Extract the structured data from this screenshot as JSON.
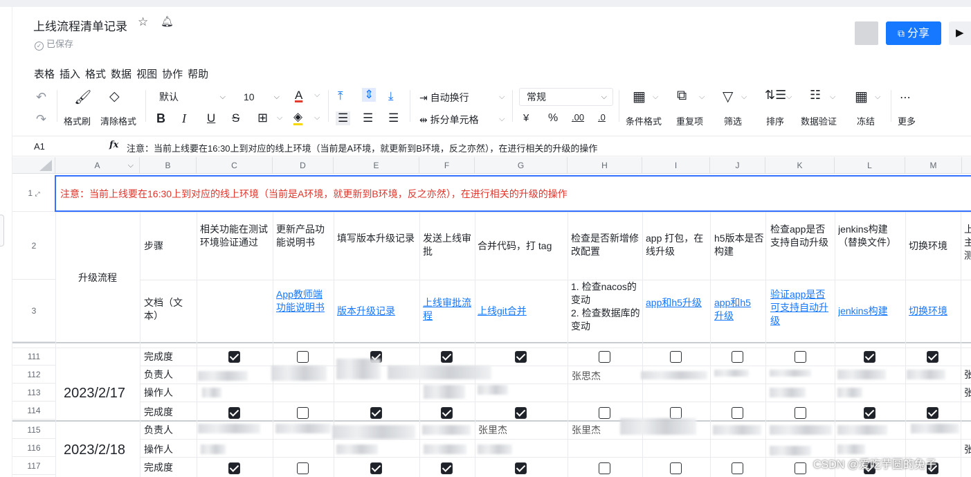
{
  "doc": {
    "title": "上线流程清单记录",
    "saved": "已保存"
  },
  "header": {
    "share_label": "分享"
  },
  "menu": [
    "表格",
    "插入",
    "格式",
    "数据",
    "视图",
    "协作",
    "帮助"
  ],
  "toolbar": {
    "format_brush": "格式刷",
    "clear_format": "清除格式",
    "font_name": "默认",
    "font_size": "10",
    "auto_wrap": "自动换行",
    "split_cell": "拆分单元格",
    "number_format": "常规",
    "yen": "¥",
    "percent": "%",
    "inc_decimal": ".00",
    "dec_decimal": ".0",
    "conditional": "条件格式",
    "duplicates": "重复项",
    "filter": "筛选",
    "sort": "排序",
    "validation": "数据验证",
    "freeze": "冻结",
    "more": "更多"
  },
  "formula": {
    "cell_ref": "A1",
    "content": "注意：当前上线要在16:30上到对应的线上环境（当前是A环境，就更新到B环境，反之亦然），在进行相关的升级的操作"
  },
  "columns": [
    "A",
    "B",
    "C",
    "D",
    "E",
    "F",
    "G",
    "H",
    "I",
    "J",
    "K",
    "L",
    "M"
  ],
  "rows": [
    "1",
    "2",
    "3",
    "111",
    "112",
    "113",
    "114",
    "115",
    "116",
    "117"
  ],
  "sheet": {
    "notice": "注意：当前上线要在16:30上到对应的线上环境（当前是A环境，就更新到B环境，反之亦然），在进行相关的升级的操作",
    "upgrade_flow": "升级流程",
    "steps_label": "步骤",
    "doc_label": "文档（文本）",
    "steps": [
      "相关功能在测试环境验证通过",
      "更新产品功能说明书",
      "填写版本升级记录",
      "发送上线审批",
      "合并代码，打 tag",
      "检查是否新增修改配置",
      "app 打包，在线升级",
      "h5版本是否构建",
      "检查app是否支持自动升级",
      "jenkins构建（替换文件）",
      "切换环境",
      "上主测"
    ],
    "docs": [
      "",
      "App教师端功能说明书",
      "版本升级记录",
      "上线审批流程",
      "上线git合并",
      "1. 检查nacos的变动\n2. 检查数据库的变动",
      "app和h5升级",
      "app和h5升级",
      "验证app是否可支持自动升级",
      "jenkins构建",
      "切换环境",
      ""
    ],
    "date1": "2023/2/17",
    "date2": "2023/2/18",
    "labels": {
      "completion": "完成度",
      "owner": "负责人",
      "operator": "操作人"
    },
    "row111_checks": [
      true,
      false,
      true,
      true,
      true,
      false,
      false,
      false,
      false,
      true,
      true
    ],
    "row114_checks": [
      true,
      false,
      true,
      true,
      true,
      false,
      false,
      false,
      false,
      true,
      true
    ],
    "row117_checks": [
      true,
      false,
      true,
      true,
      true,
      false,
      false,
      false,
      false,
      true,
      true
    ],
    "snippets": {
      "zhang": "张",
      "zhang_full": "张思杰",
      "zhang_lee": "张里杰"
    }
  },
  "watermark": "CSDN @爱吃芋圆的兔子"
}
